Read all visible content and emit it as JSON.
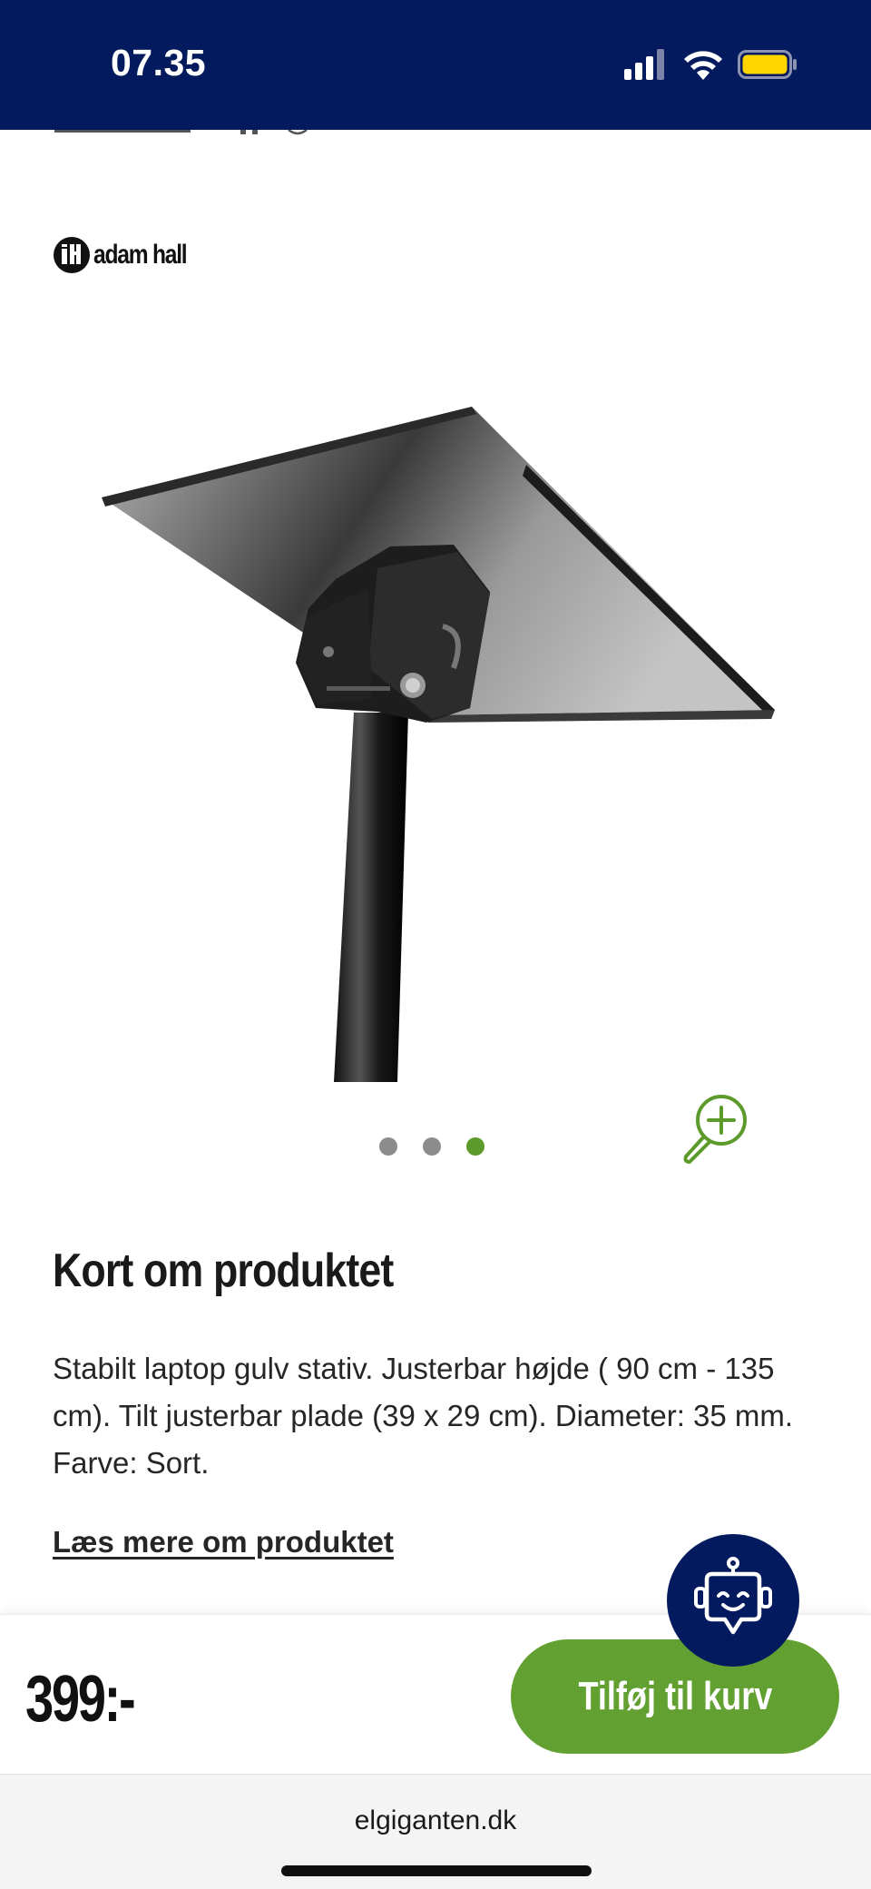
{
  "status_bar": {
    "time": "07.35",
    "icons": [
      "signal-icon",
      "wifi-icon",
      "battery-icon"
    ],
    "background": "#041a5e",
    "battery_color": "#ffd500"
  },
  "brand": {
    "logo_icon": "adam-hall-logo",
    "name": "adam hall"
  },
  "gallery": {
    "image_count": 3,
    "active_index": 2,
    "zoom_icon": "zoom-in-icon",
    "dot_color": "#8c8c8c",
    "active_dot_color": "#5c9b2b"
  },
  "summary": {
    "title": "Kort om produktet",
    "body": "Stabilt laptop gulv stativ.  Justerbar højde ( 90 cm - 135 cm).  Tilt justerbar plade  (39 x 29 cm).  Diameter: 35 mm.  Farve: Sort.",
    "read_more": "Læs mere om produktet"
  },
  "purchase": {
    "price": "399:-",
    "add_to_cart": "Tilføj til kurv",
    "button_color": "#62a032"
  },
  "chatbot": {
    "icon": "chatbot-icon"
  },
  "browser": {
    "url": "elgiganten.dk"
  }
}
